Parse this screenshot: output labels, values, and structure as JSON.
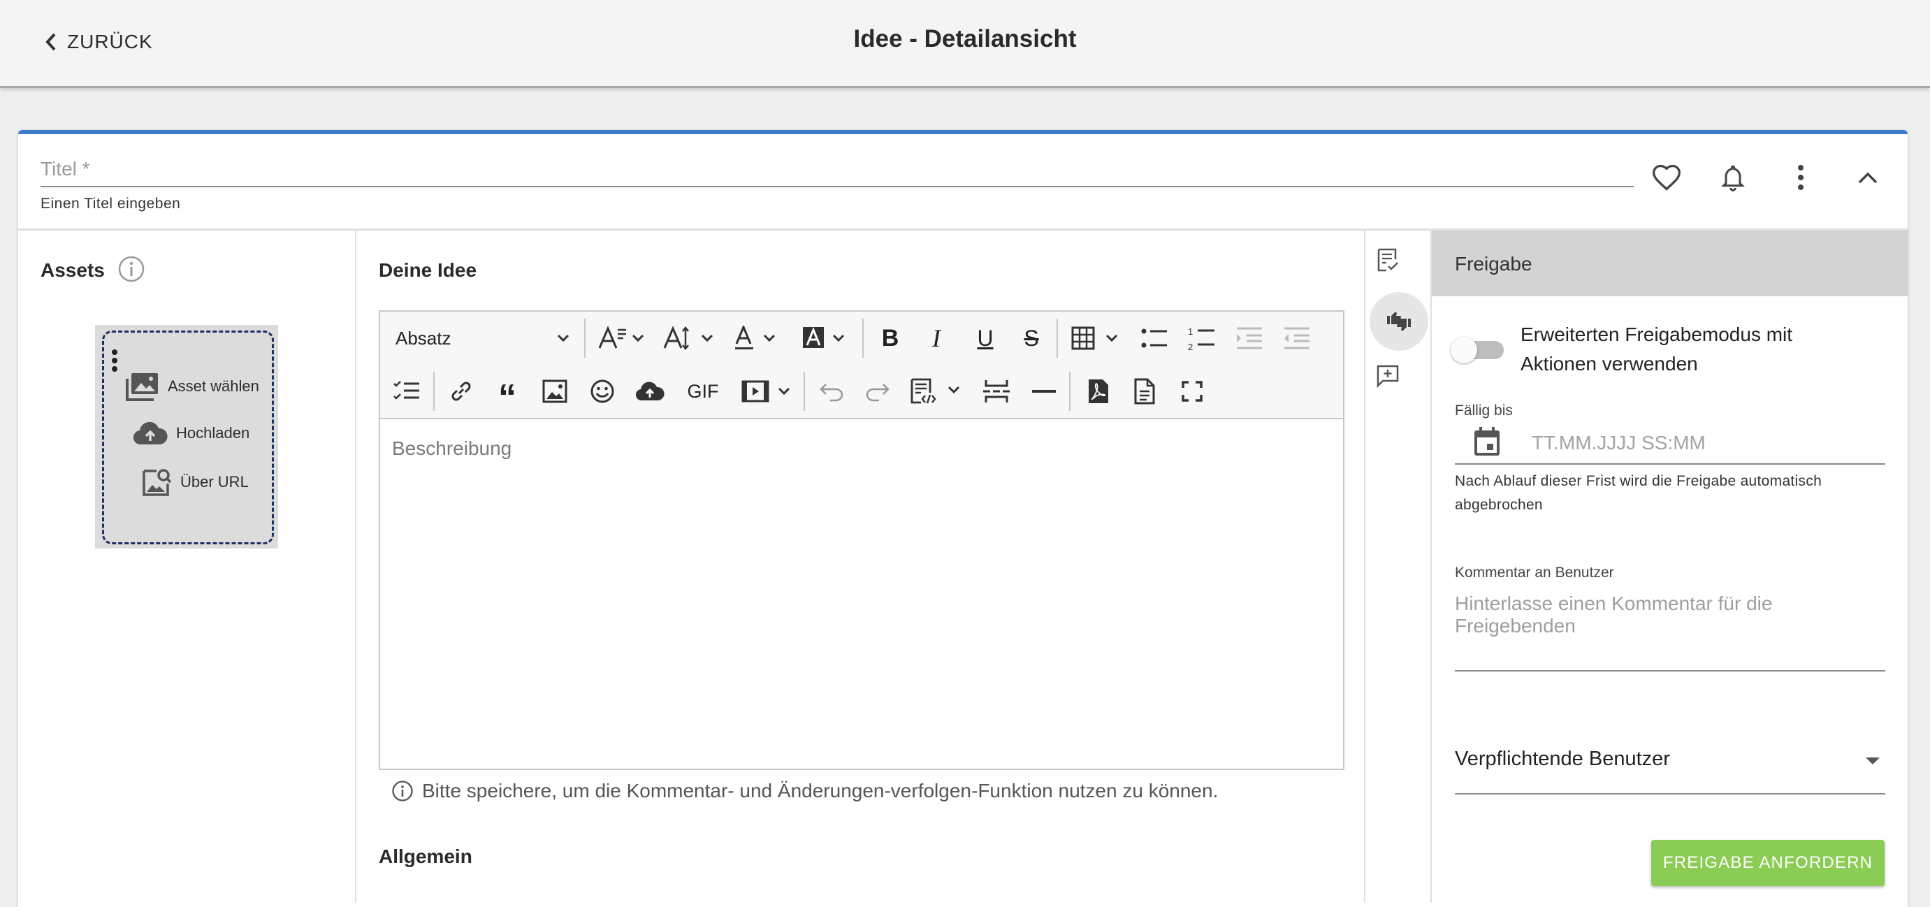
{
  "topbar": {
    "back_label": "ZURÜCK",
    "title": "Idee - Detailansicht"
  },
  "title_field": {
    "placeholder": "Titel *",
    "hint": "Einen Titel eingeben"
  },
  "header_actions": [
    "heart-icon",
    "bell-icon",
    "more-vert-icon",
    "chevron-up-icon"
  ],
  "assets": {
    "label": "Assets",
    "actions": [
      {
        "icon": "image-stack-icon",
        "label": "Asset wählen"
      },
      {
        "icon": "cloud-upload-icon",
        "label": "Hochladen"
      },
      {
        "icon": "image-search-icon",
        "label": "Über URL"
      }
    ]
  },
  "editor": {
    "section_label": "Deine Idee",
    "heading_select": "Absatz",
    "gif_label": "GIF",
    "placeholder": "Beschreibung",
    "save_hint": "Bitte speichere, um die Kommentar- und Änderungen-verfolgen-Funktion nutzen zu können."
  },
  "section_allgemein": "Allgemein",
  "rail": [
    "checklist-icon",
    "thumbs-icon",
    "add-comment-icon"
  ],
  "freigabe": {
    "title": "Freigabe",
    "toggle_label": "Erweiterten Freigabemodus mit Aktionen verwenden",
    "toggle_on": false,
    "due_label": "Fällig bis",
    "due_placeholder": "TT.MM.JJJJ SS:MM",
    "due_hint": "Nach Ablauf dieser Frist wird die Freigabe automatisch abgebrochen",
    "comment_label": "Kommentar an Benutzer",
    "comment_placeholder": "Hinterlasse einen Kommentar für die Freigebenden",
    "users_label": "Verpflichtende Benutzer",
    "submit_label": "FREIGABE ANFORDERN"
  },
  "colors": {
    "accent": "#3a7dc9",
    "submit": "#8bcc54",
    "dropzone_border": "#1d2f63"
  }
}
